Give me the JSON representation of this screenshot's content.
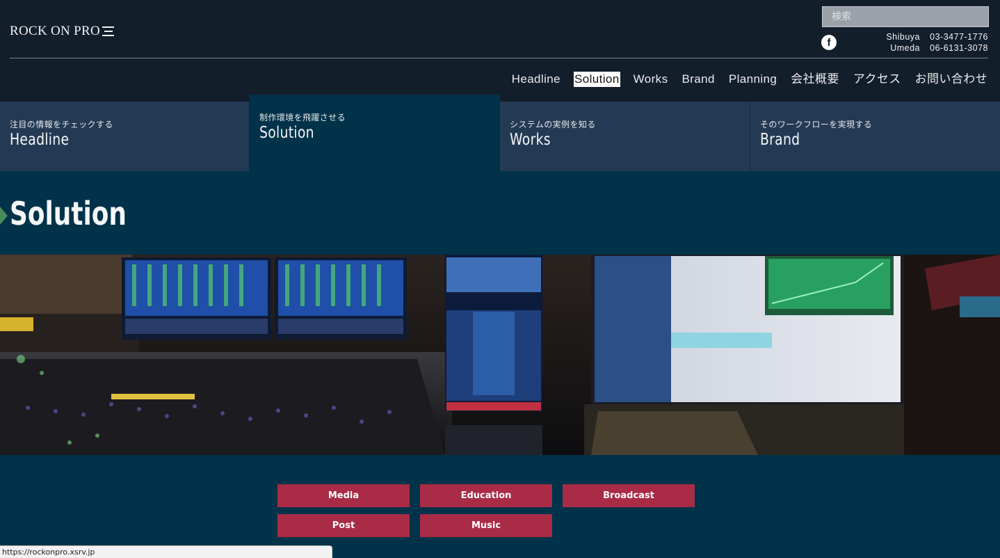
{
  "header": {
    "logo_text": "ROCK ON PRO",
    "search_placeholder": "検索",
    "social_icon": "facebook-icon",
    "phones": [
      {
        "city": "Shibuya",
        "number": "03-3477-1776"
      },
      {
        "city": "Umeda",
        "number": "06-6131-3078"
      }
    ]
  },
  "nav": {
    "items": [
      "Headline",
      "Solution",
      "Works",
      "Brand",
      "Planning",
      "会社概要",
      "アクセス",
      "お問い合わせ"
    ],
    "active": "Solution"
  },
  "tabs": [
    {
      "sub": "注目の情報をチェックする",
      "title": "Headline"
    },
    {
      "sub": "制作環境を飛躍させる",
      "title": "Solution"
    },
    {
      "sub": "システムの実例を知る",
      "title": "Works"
    },
    {
      "sub": "そのワークフローを実現する",
      "title": "Brand"
    }
  ],
  "page_title": "Solution",
  "hero_image": "mixing-console-studio-photo",
  "categories": [
    "Media",
    "Education",
    "Broadcast",
    "Post",
    "Music"
  ],
  "status_url": "https://rockonpro.xsrv.jp",
  "colors": {
    "header_bg": "#131e2b",
    "tab_bg": "#243a54",
    "page_bg": "#003249",
    "category_btn": "#a92b45",
    "title_arrow": "#4a8c5a"
  }
}
